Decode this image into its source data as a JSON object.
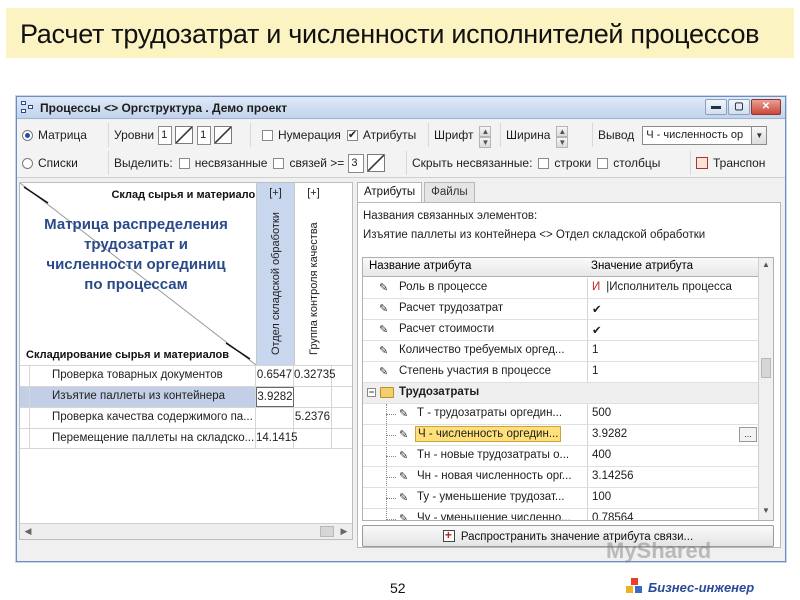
{
  "slide": {
    "title": "Расчет трудозатрат и численности исполнителей процессов",
    "page_number": "52",
    "brand": "Бизнес-инженер",
    "watermark": "MyShared"
  },
  "window": {
    "title": "Процессы <> Оргструктура . Демо проект",
    "buttons": {
      "minimize": "▬",
      "maximize": "▢",
      "close": "✕"
    }
  },
  "toolbar": {
    "row1": {
      "matrix_label": "Матрица",
      "levels_label": "Уровни",
      "level_from": "1",
      "level_to": "1",
      "numbering_label": "Нумерация",
      "attributes_label": "Атрибуты",
      "font_label": "Шрифт",
      "width_label": "Ширина",
      "output_label": "Вывод",
      "output_value": "Ч - численность ор"
    },
    "row2": {
      "lists_label": "Списки",
      "select_label": "Выделить:",
      "unlinked_label": "несвязанные",
      "links_label": "связей >=",
      "links_value": "3",
      "hide_unlinked_label": "Скрыть несвязанные:",
      "rows_label": "строки",
      "columns_label": "столбцы",
      "transpose_label": "Транспон"
    }
  },
  "matrix": {
    "top_label": "Склад сырья и материалов",
    "bottom_label": "Складирование сырья и материалов",
    "caption": "Матрица распределения трудозатрат и численности оргединиц по процессам",
    "columns": [
      {
        "plus": "[+]",
        "name": "Отдел складской обработки"
      },
      {
        "plus": "[+]",
        "name": "Группа контроля качества"
      }
    ],
    "rows": [
      {
        "name": "Проверка товарных документов",
        "v1": "0.6547",
        "v2": "0.32735"
      },
      {
        "name": "Изъятие паллеты из контейнера",
        "v1": "3.9282",
        "v2": ""
      },
      {
        "name": "Проверка качества содержимого па...",
        "v1": "",
        "v2": "5.2376"
      },
      {
        "name": "Перемещение паллеты на складско...",
        "v1": "14.1415",
        "v2": ""
      }
    ]
  },
  "attributes": {
    "tabs": [
      "Атрибуты",
      "Файлы"
    ],
    "linked_title": "Названия связанных элементов:",
    "linked_value": "Изъятие паллеты из контейнера <> Отдел складской обработки",
    "header_name": "Название атрибута",
    "header_value": "Значение атрибута",
    "rows": [
      {
        "name": "Роль в процессе",
        "prefix": "И",
        "value": "|Исполнитель процесса"
      },
      {
        "name": "Расчет трудозатрат",
        "value": "✔"
      },
      {
        "name": "Расчет стоимости",
        "value": "✔"
      },
      {
        "name": "Количество требуемых оргед...",
        "value": "1"
      },
      {
        "name": "Степень участия в процессе",
        "value": "1"
      }
    ],
    "group": "Трудозатраты",
    "group_rows": [
      {
        "name": "Т - трудозатраты оргедин...",
        "value": "500"
      },
      {
        "name": "Ч - численность оргедин...",
        "value": "3.9282",
        "button": "..."
      },
      {
        "name": "Тн - новые трудозатраты о...",
        "value": "400"
      },
      {
        "name": "Чн - новая численность орг...",
        "value": "3.14256"
      },
      {
        "name": "Ту - уменьшение трудозат...",
        "value": "100"
      },
      {
        "name": "Чу - уменьшение численно...",
        "value": "0.78564"
      }
    ],
    "spread_button": "Распространить значение атрибута связи..."
  },
  "colors": {
    "title_bg": "#fbf3c2",
    "caption": "#2a4a88",
    "selected_attr": "#ffe07a",
    "brand": "#2a4a9a"
  }
}
